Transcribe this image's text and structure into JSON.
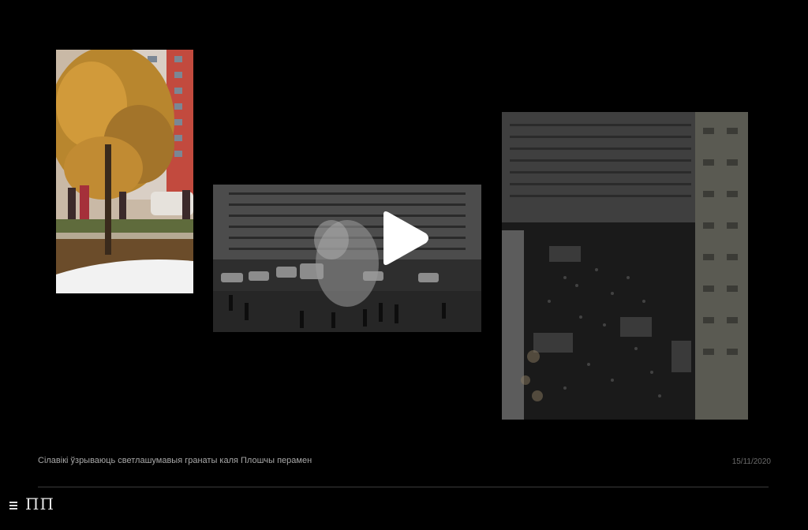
{
  "gallery": {
    "thumbnails": [
      {
        "name": "left",
        "description": "photo"
      },
      {
        "name": "middle",
        "description": "photo"
      },
      {
        "name": "right",
        "description": "photo"
      }
    ],
    "play_icon": "play-icon"
  },
  "caption": {
    "text": "Сілавікі ўзрываюць светлашумавыя гранаты каля Плошчы перамен",
    "date": "15/11/2020"
  },
  "footer": {
    "menu_icon": "hamburger-menu-icon",
    "logo": "ПП"
  },
  "colors": {
    "background": "#000000",
    "caption_text": "#a8a8a8",
    "date_text": "#6b6b6b",
    "divider": "#3a3a3a",
    "play_button": "#ffffff"
  }
}
